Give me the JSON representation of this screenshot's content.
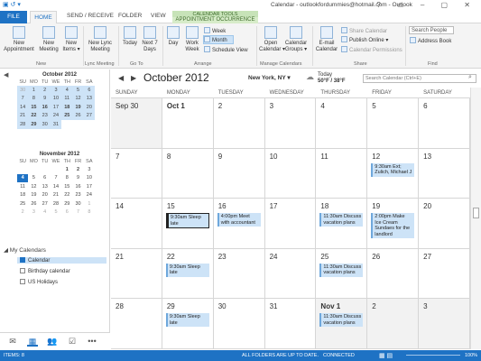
{
  "window": {
    "title": "Calendar - outlookfordummies@hotmail.com - Outlook",
    "controls": [
      "?",
      "▭",
      "–",
      "▢",
      "✕"
    ]
  },
  "tabs": {
    "file": "FILE",
    "home": "HOME",
    "send_receive": "SEND / RECEIVE",
    "folder": "FOLDER",
    "view": "VIEW",
    "context_header": "CALENDAR TOOLS",
    "context_tab": "APPOINTMENT OCCURRENCE"
  },
  "ribbon": {
    "new_appointment": "New\nAppointment",
    "new_meeting": "New\nMeeting",
    "new_items": "New\nItems ▾",
    "new_lync_meeting": "New Lync\nMeeting",
    "today": "Today",
    "next7": "Next 7\nDays",
    "day": "Day",
    "work_week": "Work\nWeek",
    "week": "Week",
    "month": "Month",
    "schedule_view": "Schedule View",
    "open_calendar": "Open\nCalendar ▾",
    "calendar_groups": "Calendar\nGroups ▾",
    "email_calendar": "E-mail\nCalendar",
    "share_calendar": "Share Calendar",
    "publish_online": "Publish Online ▾",
    "calendar_permissions": "Calendar Permissions",
    "search_people": "Search People",
    "address_book": "Address Book",
    "groups": {
      "new": "New",
      "lync": "Lync Meeting",
      "goto": "Go To",
      "arrange": "Arrange",
      "manage": "Manage Calendars",
      "share": "Share",
      "find": "Find"
    }
  },
  "mini_calendars": [
    {
      "title": "October 2012",
      "days": [
        "SU",
        "MO",
        "TU",
        "WE",
        "TH",
        "FR",
        "SA"
      ],
      "weeks": [
        [
          "30",
          "1",
          "2",
          "3",
          "4",
          "5",
          "6"
        ],
        [
          "7",
          "8",
          "9",
          "10",
          "11",
          "12",
          "13"
        ],
        [
          "14",
          "15",
          "16",
          "17",
          "18",
          "19",
          "20"
        ],
        [
          "21",
          "22",
          "23",
          "24",
          "25",
          "26",
          "27"
        ],
        [
          "28",
          "29",
          "30",
          "31",
          "",
          "",
          ""
        ]
      ]
    },
    {
      "title": "November 2012",
      "days": [
        "SU",
        "MO",
        "TU",
        "WE",
        "TH",
        "FR",
        "SA"
      ],
      "weeks": [
        [
          "",
          "",
          "",
          "",
          "1",
          "2",
          "3"
        ],
        [
          "4",
          "5",
          "6",
          "7",
          "8",
          "9",
          "10"
        ],
        [
          "11",
          "12",
          "13",
          "14",
          "15",
          "16",
          "17"
        ],
        [
          "18",
          "19",
          "20",
          "21",
          "22",
          "23",
          "24"
        ],
        [
          "25",
          "26",
          "27",
          "28",
          "29",
          "30",
          "1"
        ],
        [
          "2",
          "3",
          "4",
          "5",
          "6",
          "7",
          "8"
        ]
      ]
    }
  ],
  "my_calendars": {
    "header": "◢ My Calendars",
    "items": [
      {
        "label": "Calendar",
        "checked": true
      },
      {
        "label": "Birthday calendar",
        "checked": false
      },
      {
        "label": "US Holidays",
        "checked": false
      }
    ]
  },
  "nav_icons": [
    "mail-icon",
    "calendar-icon",
    "people-icon",
    "tasks-icon",
    "more-icon"
  ],
  "nav_glyphs": [
    "✉",
    "▦",
    "👥",
    "☑",
    "•••"
  ],
  "calendar": {
    "prev": "◀",
    "next": "▶",
    "title": "October 2012",
    "city": "New York, NY ▾",
    "weather_label": "Today",
    "weather_temp": "50°F / 38°F",
    "search_placeholder": "Search Calendar (Ctrl+E)",
    "day_names": [
      "SUNDAY",
      "MONDAY",
      "TUESDAY",
      "WEDNESDAY",
      "THURSDAY",
      "FRIDAY",
      "SATURDAY"
    ],
    "weeks": [
      [
        {
          "d": "Sep 30",
          "shade": true
        },
        {
          "d": "Oct 1",
          "bold": true
        },
        {
          "d": "2"
        },
        {
          "d": "3"
        },
        {
          "d": "4"
        },
        {
          "d": "5"
        },
        {
          "d": "6"
        }
      ],
      [
        {
          "d": "7"
        },
        {
          "d": "8"
        },
        {
          "d": "9"
        },
        {
          "d": "10"
        },
        {
          "d": "11"
        },
        {
          "d": "12",
          "appts": [
            {
              "text": "9:30am Ext; Zulich, Michael J"
            }
          ]
        },
        {
          "d": "13"
        }
      ],
      [
        {
          "d": "14"
        },
        {
          "d": "15",
          "appts": [
            {
              "text": "9:30am Sleep late",
              "selected": true
            }
          ]
        },
        {
          "d": "16",
          "appts": [
            {
              "text": "4:00pm Meet with accountant"
            }
          ]
        },
        {
          "d": "17"
        },
        {
          "d": "18",
          "appts": [
            {
              "text": "11:30am Discuss vacation plans"
            }
          ]
        },
        {
          "d": "19",
          "appts": [
            {
              "text": "2:00pm Make Ice Cream Sundaes for the landlord"
            }
          ]
        },
        {
          "d": "20"
        }
      ],
      [
        {
          "d": "21"
        },
        {
          "d": "22",
          "appts": [
            {
              "text": "9:30am Sleep late"
            }
          ]
        },
        {
          "d": "23"
        },
        {
          "d": "24"
        },
        {
          "d": "25",
          "appts": [
            {
              "text": "11:30am Discuss vacation plans"
            }
          ]
        },
        {
          "d": "26"
        },
        {
          "d": "27"
        }
      ],
      [
        {
          "d": "28"
        },
        {
          "d": "29",
          "appts": [
            {
              "text": "9:30am Sleep late"
            }
          ]
        },
        {
          "d": "30"
        },
        {
          "d": "31"
        },
        {
          "d": "Nov 1",
          "bold": true,
          "shade": true,
          "appts": [
            {
              "text": "11:30am Discuss vacation plans"
            }
          ]
        },
        {
          "d": "2",
          "shade": true
        },
        {
          "d": "3",
          "shade": true
        }
      ]
    ]
  },
  "status": {
    "items": "ITEMS: 8",
    "folders": "ALL FOLDERS ARE UP TO DATE.",
    "connected": "CONNECTED",
    "zoom": "100%"
  },
  "colors": {
    "accent": "#1e72c4",
    "appointment": "#cde3f7",
    "context_tab": "#c7e3b8"
  }
}
